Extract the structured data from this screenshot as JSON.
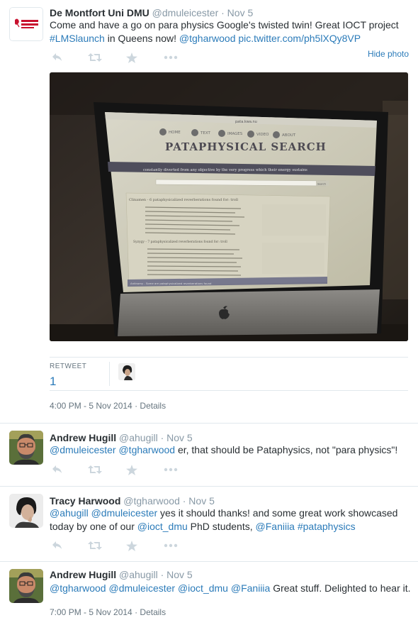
{
  "main_tweet": {
    "fullname": "De Montfort Uni DMU",
    "username": "@dmuleicester",
    "time": "· Nov 5",
    "text_before": "Come and have a go on para physics Google's twisted twin! Great IOCT project ",
    "hashtag": "#LMSlaunch",
    "text_middle": " in Queens now! ",
    "mention": "@tgharwood",
    "space": " ",
    "link": "pic.twitter.com/ph5lXQy8VP",
    "hide_photo": "Hide photo",
    "logo_text": "DE MONTFORT UNIVERSITY LEICESTER",
    "photo": {
      "browser_title": "pata.kwa.nu",
      "nav_items": [
        "HOME",
        "TEXT",
        "IMAGES",
        "VIDEO",
        "ABOUT"
      ],
      "site_title": "PATAPHYSICAL SEARCH",
      "tagline": "constantly diverted from any objective by the very progress which their energy sustains",
      "search_button": "Search",
      "results_heading": "Clinamen - 6 pataphysicalized reverberations found for: troll",
      "results_heading_2": "Syzygy - 7 pataphysicalized reverberations found for: troll",
      "footer_text": "Antinomy - Some are pataphysicalized reverberations found"
    },
    "retweet_label": "RETWEET",
    "retweet_count": "1",
    "timestamp": "4:00 PM - 5 Nov 2014",
    "details_sep": " · ",
    "details": "Details"
  },
  "replies": [
    {
      "fullname": "Andrew Hugill",
      "username": "@ahugill",
      "time": "· Nov 5",
      "mention1": "@dmuleicester",
      "sp1": " ",
      "mention2": "@tgharwood",
      "text": " er, that should be Pataphysics, not \"para physics\"!"
    },
    {
      "fullname": "Tracy Harwood",
      "username": "@tgharwood",
      "time": "· Nov 5",
      "mention1": "@ahugill",
      "sp1": " ",
      "mention2": "@dmuleicester",
      "text1": " yes it should thanks! and some great work showcased today by one of our ",
      "mention3": "@ioct_dmu",
      "text2": " PhD students, ",
      "mention4": "@Faniiia",
      "sp2": " ",
      "hashtag": "#pataphysics"
    },
    {
      "fullname": "Andrew Hugill",
      "username": "@ahugill",
      "time": "· Nov 5",
      "mention1": "@tgharwood",
      "sp1": " ",
      "mention2": "@dmuleicester",
      "sp2": " ",
      "mention3": "@ioct_dmu",
      "sp3": " ",
      "mention4": "@Faniiia",
      "text": " Great stuff. Delighted to hear it.",
      "timestamp": "7:00 PM - 5 Nov 2014",
      "details_sep": " · ",
      "details": "Details"
    }
  ],
  "icons": [
    "reply-icon",
    "retweet-icon",
    "favorite-icon",
    "more-icon"
  ],
  "colors": {
    "link": "#2b7bb9",
    "muted": "#8899a6",
    "text": "#292f33",
    "icon": "#ccd6dd",
    "border": "#e1e8ed",
    "dmu_red": "#c8102e"
  }
}
